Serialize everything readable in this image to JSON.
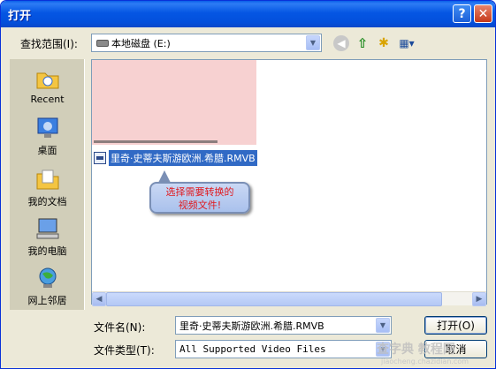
{
  "window": {
    "title": "打开",
    "help_label": "?",
    "close_label": "✕"
  },
  "toolbar": {
    "look_in_label": "查找范围(I):",
    "look_in_value": "本地磁盘 (E:)",
    "dropdown_arrow": "▼",
    "icons": [
      "back-icon",
      "up-folder-icon",
      "new-folder-icon",
      "view-menu-icon"
    ]
  },
  "places": [
    {
      "label": "Recent",
      "icon": "recent-folder-icon"
    },
    {
      "label": "桌面",
      "icon": "desktop-icon"
    },
    {
      "label": "我的文档",
      "icon": "my-documents-icon"
    },
    {
      "label": "我的电脑",
      "icon": "my-computer-icon"
    },
    {
      "label": "网上邻居",
      "icon": "network-icon"
    }
  ],
  "files": [
    {
      "name": "里奇·史蒂夫斯游欧洲.希腊.RMVB",
      "selected": true
    }
  ],
  "callout": {
    "line1": "选择需要转换的",
    "line2": "视频文件!"
  },
  "fields": {
    "filename_label": "文件名(N):",
    "filename_value": "里奇·史蒂夫斯游欧洲.希腊.RMVB",
    "filetype_label": "文件类型(T):",
    "filetype_value": "All Supported Video Files"
  },
  "buttons": {
    "open_label": "打开(O)",
    "cancel_label": "取消"
  },
  "watermark": {
    "text": "查字典 教程网",
    "url": "jiaocheng.chazidian.com"
  },
  "colors": {
    "title_bar": "#0556e3",
    "selection": "#316ac5",
    "callout_text": "#e0191e"
  }
}
